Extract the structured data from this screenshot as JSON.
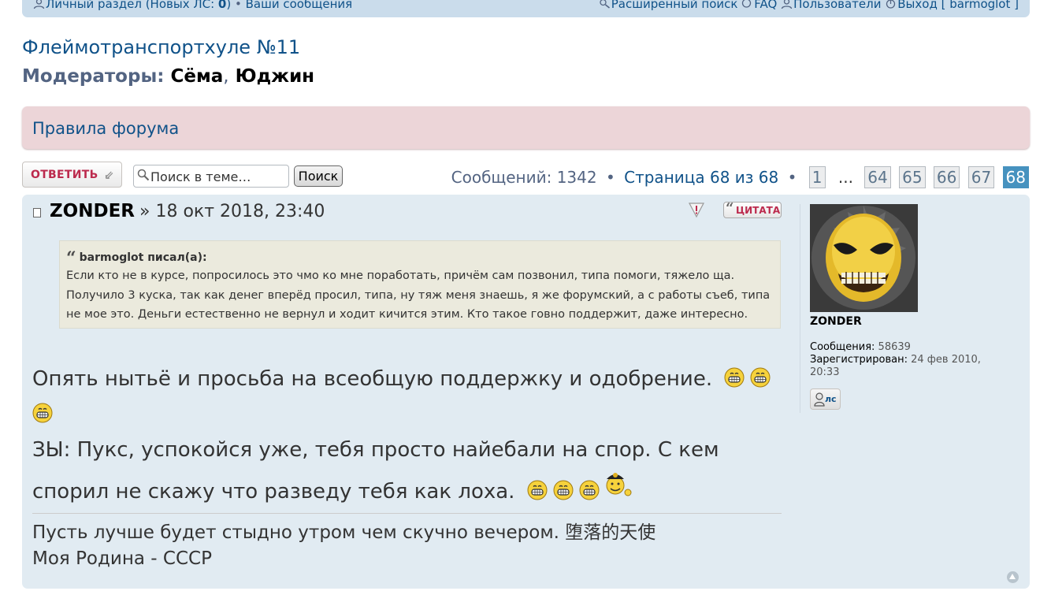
{
  "topbar": {
    "left_prefix": "Личный раздел (Новых ЛС: ",
    "unread_count": "0",
    "left_suffix": ")",
    "separator": "•",
    "messages_link": "Ваши сообщения",
    "advanced_search": "Расширенный поиск",
    "faq": "FAQ",
    "users": "Пользователи",
    "logout": "Выход [ barmoglot ]"
  },
  "forum": {
    "title": "Флеймотранспортхуле №11",
    "moderators_label": "Модераторы:",
    "moderators": [
      "Сёма",
      "Юджин"
    ],
    "comma": ","
  },
  "rules": {
    "label": "Правила форума"
  },
  "toolbar": {
    "reply_label": "ОТВЕТИТЬ",
    "search_placeholder": "Поиск в теме…",
    "search_button": "Поиск"
  },
  "pagination": {
    "count_text": "Сообщений: 1342",
    "separator": "•",
    "page_info": "Страница 68 из 68",
    "first_page": "1",
    "ellipsis": "...",
    "pages": [
      "64",
      "65",
      "66",
      "67"
    ],
    "current_page": "68"
  },
  "post": {
    "author": "ZONDER",
    "date": "» 18 окт 2018, 23:40",
    "quote_button": "ЦИТАТА",
    "quote": {
      "cite": "barmoglot писал(а):",
      "text": "Если кто не в курсе, попросилось это чмо ко мне поработать, причём сам позвонил, типа помоги, тяжело ща. Получило 3 куска, так как денег вперёд просил, типа, ну тяж меня знаешь, я же форумский, а с работы съеб, типа не мое это. Деньги естественно не вернул и ходит кичится этим. Кто такое говно поддержит, даже интересно."
    },
    "line1": "Опять нытьё и просьба на всеобщую поддержку и одобрение.",
    "line2": "ЗЫ: Пукс, успокойся уже, тебя просто найебали на спор. С кем спорил не скажу что разведу тебя как лоха.",
    "signature_line1": "Пусть лучше будет стыдно утром чем скучно вечером. 堕落的天使",
    "signature_line2": "Моя Родина - СССР"
  },
  "profile": {
    "name": "ZONDER",
    "posts_label": "Сообщения:",
    "posts_value": "58639",
    "registered_label": "Зарегистрирован:",
    "registered_value": "24 фев 2010, 20:33",
    "pm_label": "лс"
  },
  "colors": {
    "link": "#105289",
    "post_bg": "#e1ebf2",
    "rules_bg": "#ecd5d8",
    "current_page_bg": "#4692bf",
    "reply_text": "#bc2a4d",
    "quote_bg": "#ebeadd"
  },
  "icons": [
    "user-icon",
    "search-icon",
    "help-icon",
    "users-icon",
    "power-icon",
    "post-icon",
    "report-icon",
    "quote-icon",
    "grin-smiley-icon",
    "pm-user-icon",
    "back-to-top-icon"
  ]
}
